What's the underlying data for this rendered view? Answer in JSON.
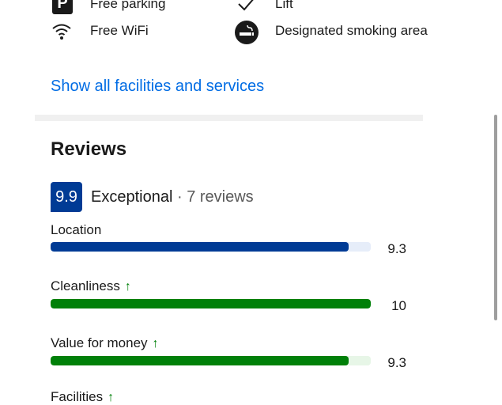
{
  "facilities": [
    {
      "label": "Free parking",
      "icon": "parking-icon"
    },
    {
      "label": "Lift",
      "icon": "checkmark-icon"
    },
    {
      "label": "Free WiFi",
      "icon": "wifi-icon"
    },
    {
      "label": "Designated smoking area",
      "icon": "smoking-icon"
    }
  ],
  "facilities_link": "Show all facilities and services",
  "reviews": {
    "heading": "Reviews",
    "score": "9.9",
    "score_word": "Exceptional",
    "separator": " · ",
    "count": "7 reviews",
    "categories": [
      {
        "label": "Location",
        "score": "9.3",
        "fill": 0.93,
        "color": "#003b95",
        "track": "#e6edf9",
        "arrow": ""
      },
      {
        "label": "Cleanliness",
        "score": "10",
        "fill": 1.0,
        "color": "#008009",
        "track": "#e7f6e7",
        "arrow": "↑"
      },
      {
        "label": "Value for money",
        "score": "9.3",
        "fill": 0.93,
        "color": "#008009",
        "track": "#e7f6e7",
        "arrow": "↑"
      },
      {
        "label": "Facilities",
        "score": "",
        "fill": 0,
        "color": "#008009",
        "track": "#e7f6e7",
        "arrow": "↑"
      }
    ]
  },
  "colors": {
    "link": "#006ce4",
    "badge": "#003b95",
    "good": "#008009"
  }
}
